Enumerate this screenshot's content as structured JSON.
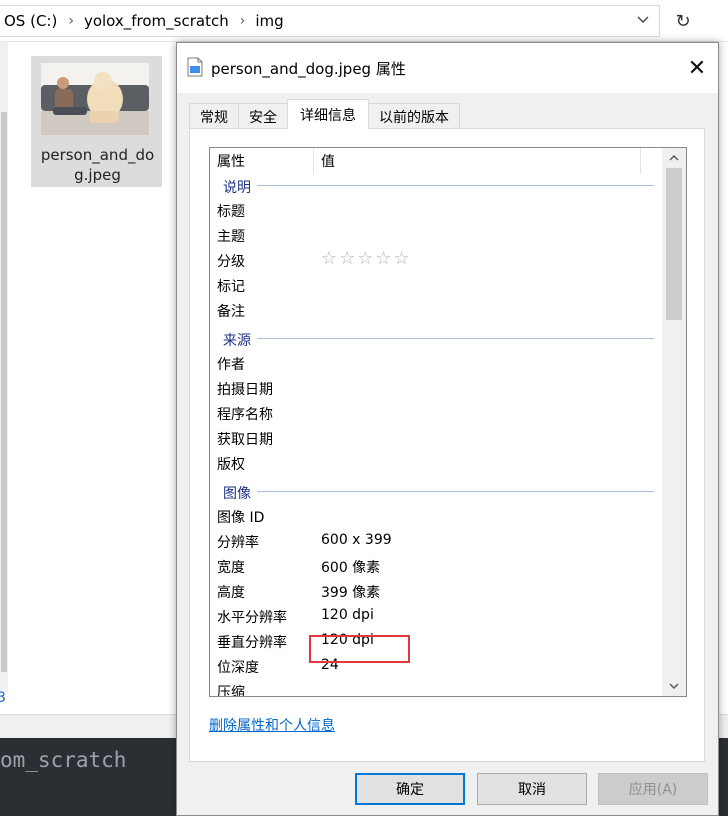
{
  "explorer": {
    "breadcrumbs": [
      "OS (C:)",
      "yolox_from_scratch",
      "img"
    ],
    "file": {
      "name": "person_and_dog.jpeg"
    },
    "left_fragment": "3",
    "terminal_text": "om_scratch"
  },
  "dialog": {
    "title": "person_and_dog.jpeg 属性",
    "close_glyph": "✕",
    "tabs": [
      "常规",
      "安全",
      "详细信息",
      "以前的版本"
    ],
    "active_tab": "详细信息",
    "columns": {
      "property": "属性",
      "value": "值"
    },
    "groups": [
      {
        "label": "说明",
        "rows": [
          {
            "key": "标题",
            "value": ""
          },
          {
            "key": "主题",
            "value": ""
          },
          {
            "key": "分级",
            "value": "☆☆☆☆☆",
            "rating": 0
          },
          {
            "key": "标记",
            "value": ""
          },
          {
            "key": "备注",
            "value": ""
          }
        ]
      },
      {
        "label": "来源",
        "rows": [
          {
            "key": "作者",
            "value": ""
          },
          {
            "key": "拍摄日期",
            "value": ""
          },
          {
            "key": "程序名称",
            "value": ""
          },
          {
            "key": "获取日期",
            "value": ""
          },
          {
            "key": "版权",
            "value": ""
          }
        ]
      },
      {
        "label": "图像",
        "rows": [
          {
            "key": "图像 ID",
            "value": ""
          },
          {
            "key": "分辨率",
            "value": "600 x 399"
          },
          {
            "key": "宽度",
            "value": "600 像素"
          },
          {
            "key": "高度",
            "value": "399 像素"
          },
          {
            "key": "水平分辨率",
            "value": "120 dpi"
          },
          {
            "key": "垂直分辨率",
            "value": "120 dpi"
          },
          {
            "key": "位深度",
            "value": "24"
          },
          {
            "key": "压缩",
            "value": ""
          }
        ]
      }
    ],
    "remove_link": "删除属性和个人信息",
    "buttons": {
      "ok": "确定",
      "cancel": "取消",
      "apply": "应用(A)"
    }
  },
  "colors": {
    "accent": "#0078d7",
    "highlight_box": "#e0383e",
    "group_label": "#1e3287",
    "link": "#0066cc"
  },
  "icons": [
    "chevron-right-icon",
    "chevron-down-icon",
    "refresh-icon",
    "file-icon",
    "close-icon",
    "scroll-up-icon",
    "scroll-down-icon"
  ]
}
